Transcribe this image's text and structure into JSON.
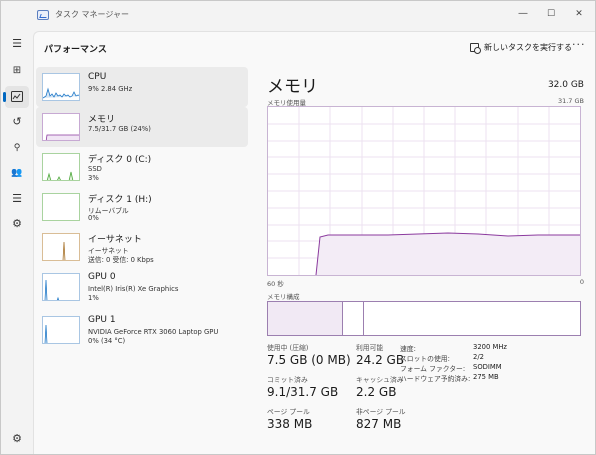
{
  "app": {
    "title": "タスク マネージャー"
  },
  "window_controls": {
    "minimize": "—",
    "maximize": "☐",
    "close": "✕"
  },
  "nav": {
    "menu": "☰",
    "processes": "⊞",
    "performance": "📈",
    "history": "↺",
    "startup": "⚲",
    "users": "👥",
    "details": "☰",
    "services": "⚙",
    "settings": "⚙"
  },
  "header": {
    "title": "パフォーマンス",
    "run_task": "新しいタスクを実行する",
    "more": "···"
  },
  "perf_items": [
    {
      "name": "CPU",
      "lines": [
        "9% 2.84 GHz"
      ]
    },
    {
      "name": "メモリ",
      "lines": [
        "7.5/31.7 GB (24%)"
      ]
    },
    {
      "name": "ディスク 0 (C:)",
      "lines": [
        "SSD",
        "3%"
      ]
    },
    {
      "name": "ディスク 1 (H:)",
      "lines": [
        "リムーバブル",
        "0%"
      ]
    },
    {
      "name": "イーサネット",
      "lines": [
        "イーサネット",
        "送信: 0 受信: 0 Kbps"
      ]
    },
    {
      "name": "GPU 0",
      "lines": [
        "Intel(R) Iris(R) Xe Graphics",
        "1%"
      ]
    },
    {
      "name": "GPU 1",
      "lines": [
        "NVIDIA GeForce RTX 3060 Laptop GPU",
        "0% (34 °C)"
      ]
    }
  ],
  "memory": {
    "title": "メモリ",
    "total": "32.0 GB",
    "usage_label": "メモリ使用量",
    "max_label": "31.7 GB",
    "x_left": "60 秒",
    "x_right": "0",
    "composition_label": "メモリ構成",
    "composition": {
      "in_use_fraction": 0.24,
      "modified_fraction": 0.067
    },
    "stats": [
      {
        "label": "使用中 (圧縮)",
        "value": "7.5 GB (0 MB)"
      },
      {
        "label": "利用可能",
        "value": "24.2 GB"
      },
      {
        "label": "コミット済み",
        "value": "9.1/31.7 GB"
      },
      {
        "label": "キャッシュ済み",
        "value": "2.2 GB"
      },
      {
        "label": "ページ プール",
        "value": "338 MB"
      },
      {
        "label": "非ページ プール",
        "value": "827 MB"
      }
    ],
    "specs": [
      {
        "label": "速度:",
        "value": "3200 MHz"
      },
      {
        "label": "スロットの使用:",
        "value": "2/2"
      },
      {
        "label": "フォーム ファクター:",
        "value": "SODIMM"
      },
      {
        "label": "ハードウェア予約済み:",
        "value": "275 MB"
      }
    ]
  },
  "colors": {
    "accent": "#0067c0",
    "memory": "#8b3a9e",
    "cpu": "#1e78c8",
    "disk": "#4ca73a",
    "ethernet": "#a7722a"
  }
}
